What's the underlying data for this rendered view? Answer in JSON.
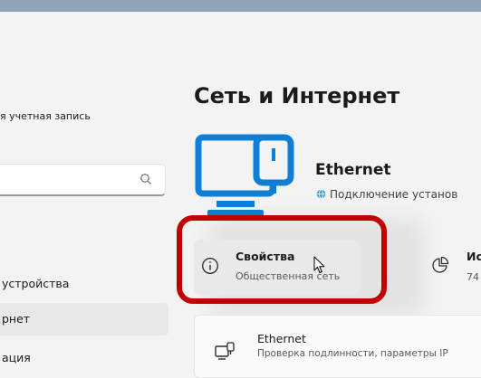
{
  "sidebar": {
    "account_text": "я учетная запись",
    "search_placeholder": "",
    "items": [
      {
        "label": "устройства"
      },
      {
        "label": "рнет"
      },
      {
        "label": "ация"
      }
    ]
  },
  "main": {
    "title": "Сеть и Интернет",
    "adapter": {
      "name": "Ethernet",
      "status": "Подключение установ"
    },
    "properties_card": {
      "title": "Свойства",
      "subtitle": "Общественная сеть"
    },
    "usage_card": {
      "title": "Ис",
      "subtitle": "74"
    },
    "list_item": {
      "title": "Ethernet",
      "subtitle": "Проверка подлинности, параметры IP"
    }
  },
  "colors": {
    "accent": "#0078d4",
    "highlight": "#c10000",
    "topbar": "#8fa4b8"
  },
  "icons": {
    "search": "search-icon",
    "pc": "computer-network-icon",
    "globe": "globe-icon",
    "info": "info-icon",
    "usage": "pie-chart-icon",
    "ethernet": "ethernet-icon",
    "cursor": "mouse-cursor-icon"
  }
}
